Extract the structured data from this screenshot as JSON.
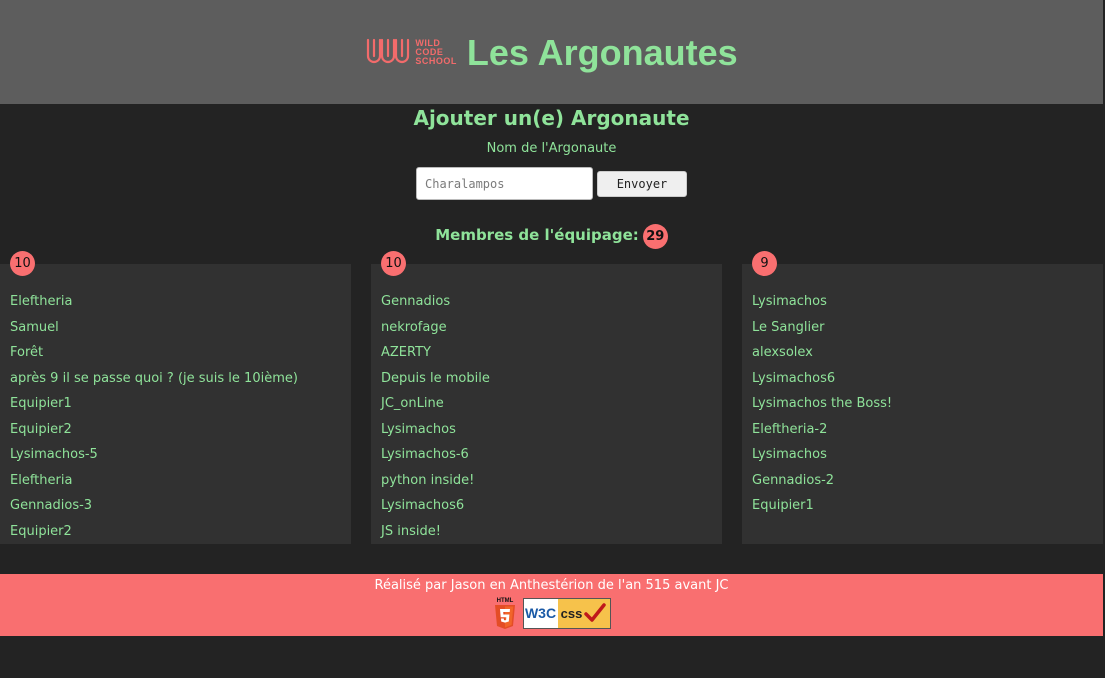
{
  "header": {
    "logo_lines": [
      "WILD",
      "CODE",
      "SCHOOL"
    ],
    "title": "Les Argonautes"
  },
  "form": {
    "title": "Ajouter un(e) Argonaute",
    "label": "Nom de l'Argonaute",
    "input_placeholder": "Charalampos",
    "submit_label": "Envoyer"
  },
  "crew": {
    "label": "Membres de l'équipage:",
    "count": "29"
  },
  "columns": [
    {
      "count": "10",
      "members": [
        "Eleftheria",
        "Samuel",
        "Forêt",
        "après 9 il se passe quoi ? (je suis le 10ième)",
        "Equipier1",
        "Equipier2",
        "Lysimachos-5",
        "Eleftheria",
        "Gennadios-3",
        "Equipier2"
      ]
    },
    {
      "count": "10",
      "members": [
        "Gennadios",
        "nekrofage",
        "AZERTY",
        "Depuis le mobile",
        "JC_onLine",
        "Lysimachos",
        "Lysimachos-6",
        "python inside!",
        "Lysimachos6",
        "JS inside!"
      ]
    },
    {
      "count": "9",
      "members": [
        "Lysimachos",
        "Le Sanglier",
        "alexsolex",
        "Lysimachos6",
        "Lysimachos the Boss!",
        "Eleftheria-2",
        "Lysimachos",
        "Gennadios-2",
        "Equipier1"
      ]
    }
  ],
  "footer": {
    "text": "Réalisé par Jason en Anthestérion de l'an 515 avant JC",
    "html5_label": "HTML",
    "w3c_left": "W3C",
    "w3c_right": "css"
  },
  "colors": {
    "accent_green": "#8fe39a",
    "accent_red": "#f96f70",
    "header_bg": "#5d5d5d",
    "page_bg": "#232323"
  }
}
